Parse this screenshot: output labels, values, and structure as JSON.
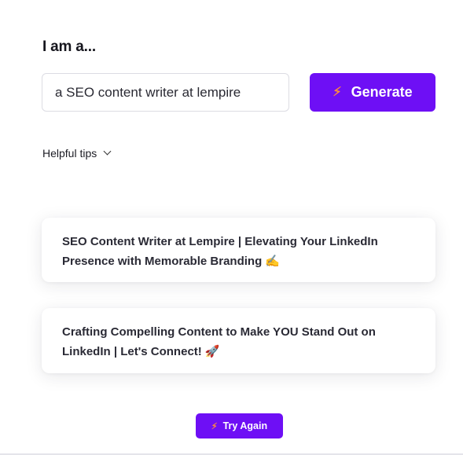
{
  "prompt": {
    "heading": "I am a...",
    "input_value": "a SEO content writer at lempire",
    "generate_label": "Generate",
    "generate_icon": "lightning-icon"
  },
  "tips": {
    "label": "Helpful tips",
    "icon": "chevron-down-icon"
  },
  "results": [
    {
      "text": "SEO Content Writer at Lempire | Elevating Your LinkedIn Presence with Memorable Branding",
      "emoji": "✍️"
    },
    {
      "text": "Crafting Compelling Content to Make YOU Stand Out on LinkedIn | Let's Connect!",
      "emoji": "🚀"
    }
  ],
  "try_again": {
    "label": "Try Again",
    "icon": "lightning-icon"
  },
  "colors": {
    "accent": "#6e0ff5",
    "bolt": "#ff8a3d",
    "text": "#1c1c24"
  }
}
